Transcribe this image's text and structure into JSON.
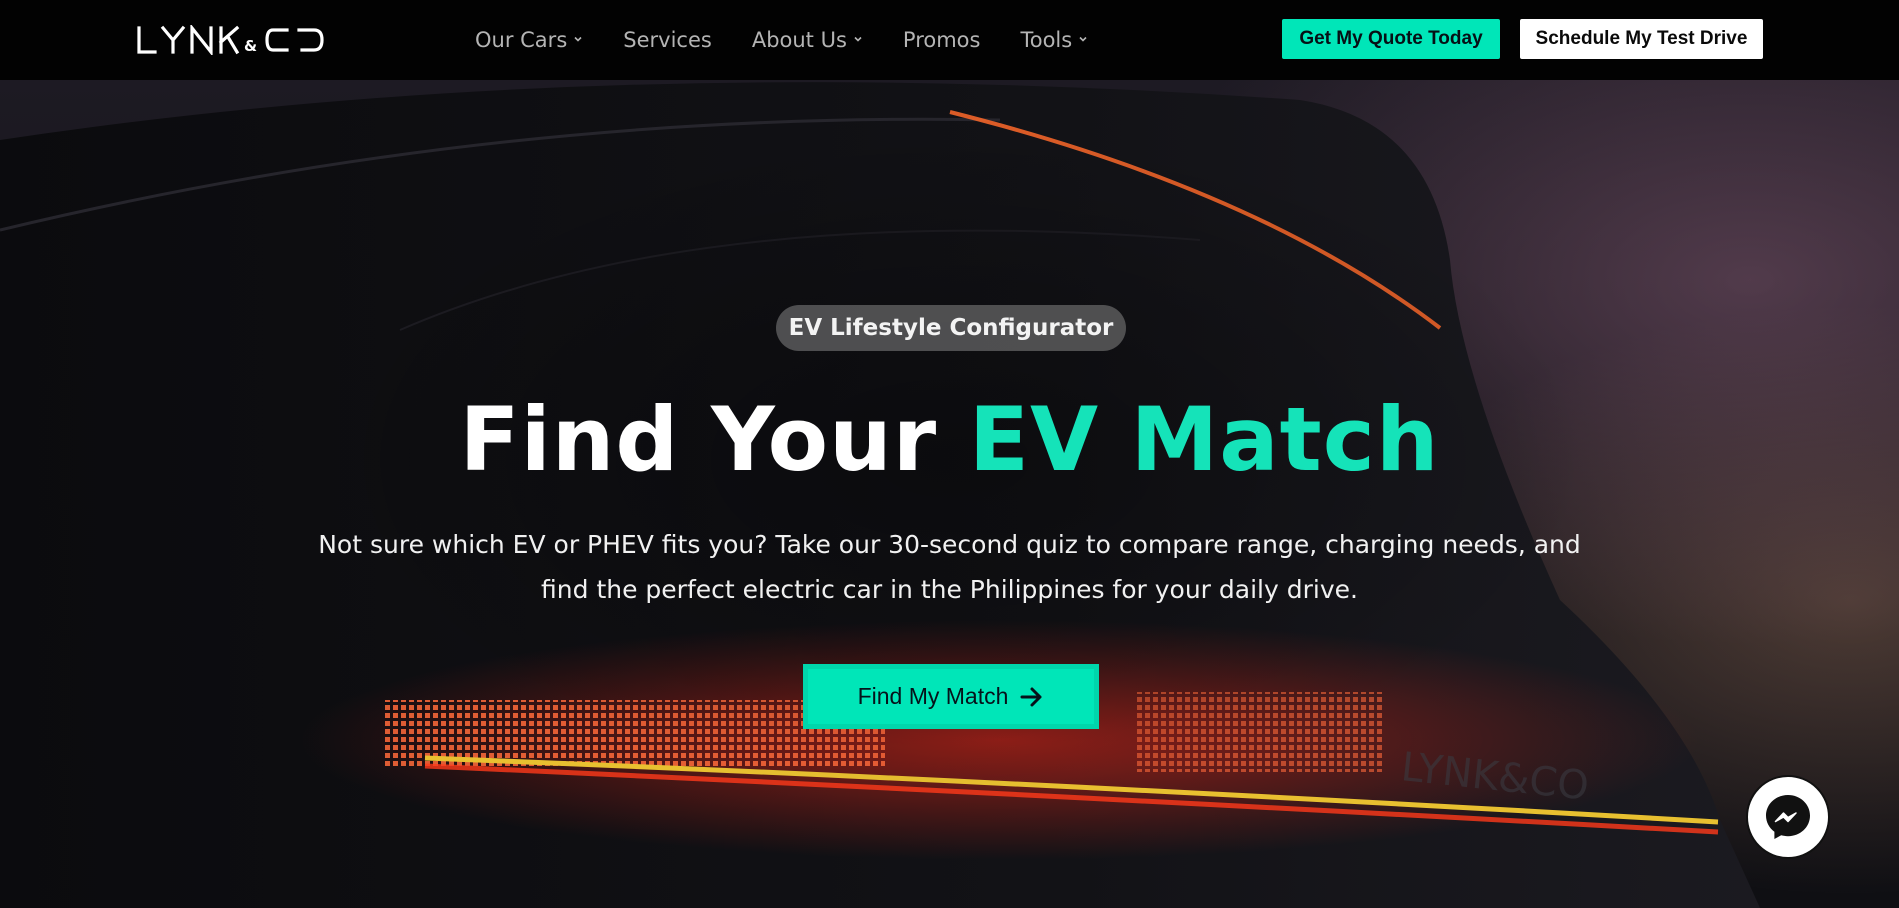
{
  "brand": {
    "logo_text": "LYNK&CO"
  },
  "nav": {
    "items": [
      {
        "label": "Our Cars",
        "has_dropdown": true
      },
      {
        "label": "Services",
        "has_dropdown": false
      },
      {
        "label": "About Us",
        "has_dropdown": true
      },
      {
        "label": "Promos",
        "has_dropdown": false
      },
      {
        "label": "Tools",
        "has_dropdown": true
      }
    ],
    "quote_button": "Get My Quote Today",
    "test_drive_button": "Schedule My Test Drive"
  },
  "hero": {
    "badge": "EV Lifestyle Configurator",
    "headline_main": "Find Your ",
    "headline_accent": "EV Match",
    "description": "Not sure which EV or PHEV fits you? Take our 30-second quiz to compare range, charging needs, and find the perfect electric car in the Philippines for your daily drive.",
    "cta_label": "Find My Match",
    "cta_icon": "arrow-right-icon"
  },
  "chat": {
    "icon": "messenger-icon"
  },
  "colors": {
    "accent": "#00e6b8",
    "header_bg": "#020202",
    "text_light": "#ffffff",
    "nav_text": "#b4b4b4"
  }
}
